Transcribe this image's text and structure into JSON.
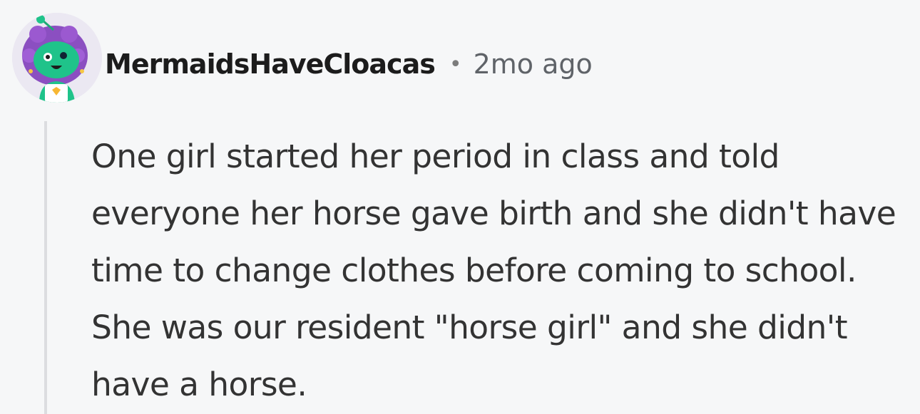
{
  "comment": {
    "username": "MermaidsHaveCloacas",
    "separator": "•",
    "timestamp": "2mo ago",
    "body": "One girl started her period in class and told everyone her horse gave birth and she didn't have time to change clothes before coming to school. She was our resident \"horse girl\" and she didn't have a horse.",
    "avatar_icon": "snoo-avatar-icon"
  },
  "colors": {
    "background": "#f6f7f8",
    "username": "#1c1c1c",
    "meta": "#5f6368",
    "body": "#333333",
    "thread_line": "#dcdde0",
    "avatar_green": "#1fc38a",
    "avatar_hair": "#8b4fc1"
  }
}
